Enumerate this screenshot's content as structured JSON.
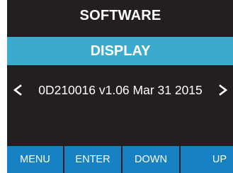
{
  "screen": {
    "title": "SOFTWARE",
    "section": "DISPLAY",
    "value": "0D210016 v1.06 Mar 31 2015",
    "prev_icon": "chevron-left-icon",
    "next_icon": "chevron-right-icon"
  },
  "softkeys": {
    "menu": "MENU",
    "enter": "ENTER",
    "down": "DOWN",
    "up": "UP"
  },
  "colors": {
    "screen_background": "#231f20",
    "section_bar": "#3aaacd",
    "softkey_background": "#1681c3",
    "text": "#ffffff"
  }
}
